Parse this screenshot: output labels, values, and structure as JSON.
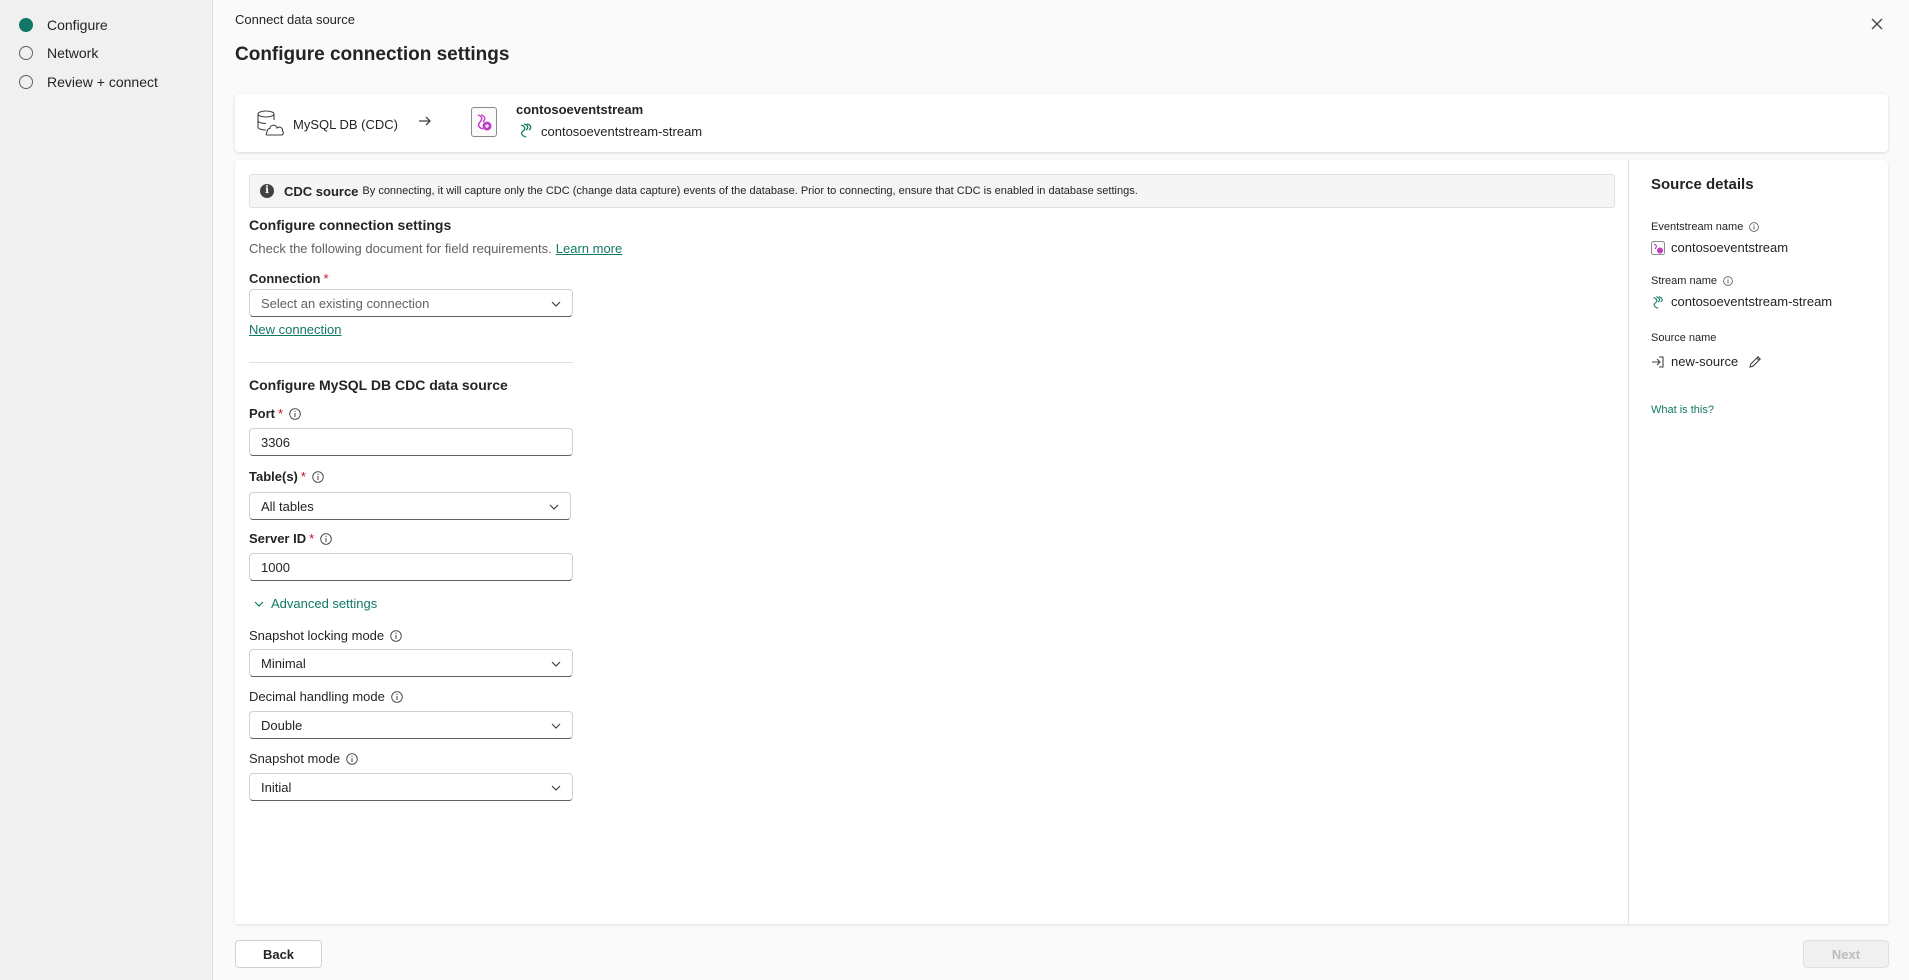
{
  "stepper": {
    "steps": [
      {
        "label": "Configure",
        "active": true
      },
      {
        "label": "Network",
        "active": false
      },
      {
        "label": "Review + connect",
        "active": false
      }
    ]
  },
  "header": {
    "breadcrumb": "Connect data source",
    "title": "Configure connection settings"
  },
  "flow": {
    "source_name": "MySQL DB (CDC)",
    "source_icon": "database-cloud-icon",
    "arrow_icon": "arrow-right-icon",
    "dest_name": "contosoeventstream",
    "dest_icon": "eventstream-icon",
    "dest_stream": "contosoeventstream-stream",
    "stream_icon": "stream-icon"
  },
  "info_bar": {
    "title": "CDC source",
    "text": "By connecting, it will capture only the CDC (change data capture) events of the database. Prior to connecting, ensure that CDC is enabled in database settings."
  },
  "connection_section": {
    "title": "Configure connection settings",
    "subtitle": "Check the following document for field requirements.",
    "learn_more": "Learn more",
    "connection_label": "Connection",
    "required_mark": "*",
    "connection_placeholder": "Select an existing connection",
    "new_connection": "New connection"
  },
  "source_section": {
    "title": "Configure MySQL DB CDC data source",
    "port_label": "Port",
    "port_value": "3306",
    "tables_label": "Table(s)",
    "tables_value": "All tables",
    "server_id_label": "Server ID",
    "server_id_value": "1000",
    "advanced_label": "Advanced settings",
    "snapshot_locking_label": "Snapshot locking mode",
    "snapshot_locking_value": "Minimal",
    "decimal_label": "Decimal handling mode",
    "decimal_value": "Double",
    "snapshot_mode_label": "Snapshot mode",
    "snapshot_mode_value": "Initial"
  },
  "details": {
    "title": "Source details",
    "eventstream_label": "Eventstream name",
    "eventstream_value": "contosoeventstream",
    "stream_label": "Stream name",
    "stream_value": "contosoeventstream-stream",
    "source_label": "Source name",
    "source_value": "new-source",
    "what_is_this": "What is this?"
  },
  "footer": {
    "back": "Back",
    "next": "Next"
  },
  "colors": {
    "accent": "#117865",
    "required": "#c50f1f",
    "eventstream": "#c03bc4"
  }
}
